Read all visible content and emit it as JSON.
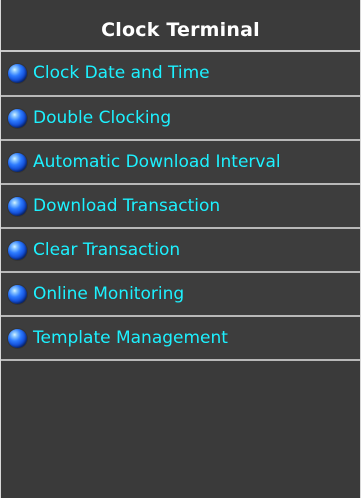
{
  "panel": {
    "title": "Clock Terminal",
    "items": [
      {
        "label": "Clock Date and Time",
        "icon": "blue-sphere-icon"
      },
      {
        "label": "Double Clocking",
        "icon": "blue-sphere-icon"
      },
      {
        "label": "Automatic Download Interval",
        "icon": "blue-sphere-icon"
      },
      {
        "label": "Download Transaction",
        "icon": "blue-sphere-icon"
      },
      {
        "label": "Clear Transaction",
        "icon": "blue-sphere-icon"
      },
      {
        "label": "Online Monitoring",
        "icon": "blue-sphere-icon"
      },
      {
        "label": "Template Management",
        "icon": "blue-sphere-icon"
      }
    ]
  },
  "colors": {
    "background": "#3a3a3a",
    "text": "#1df1ff",
    "header_text": "#ffffff",
    "divider": "#b8b8b8",
    "bullet": "#2d7bff"
  }
}
